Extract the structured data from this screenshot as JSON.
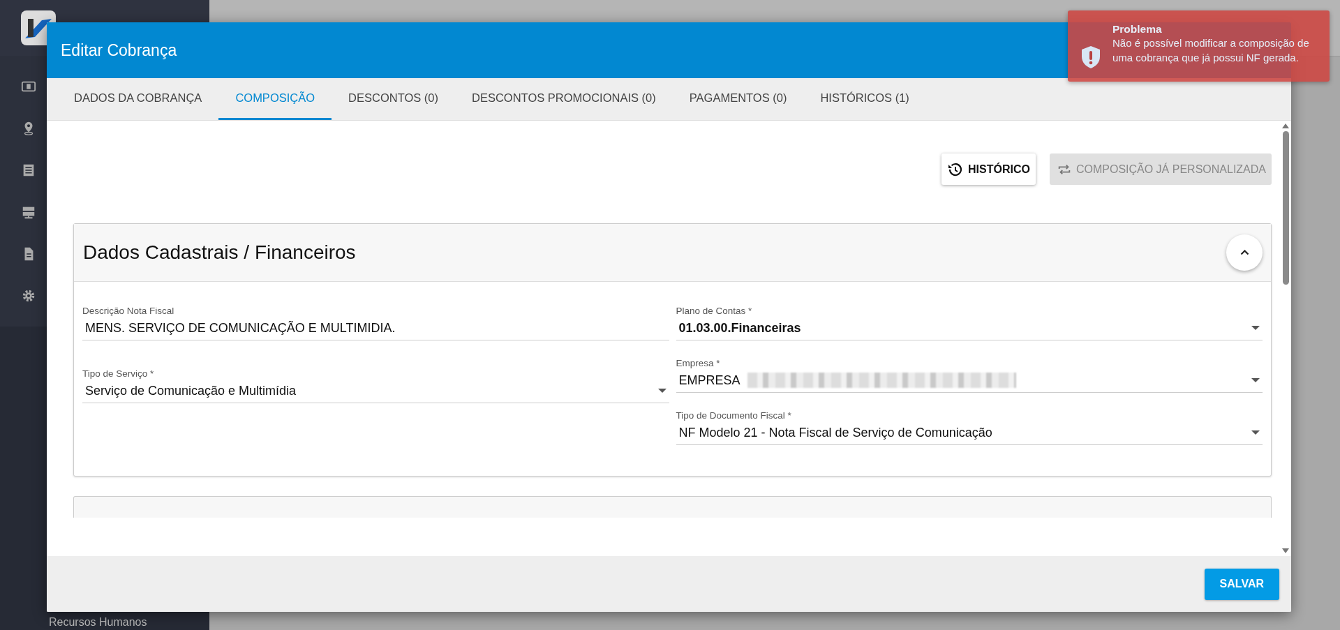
{
  "sidebar": {
    "items": [
      {
        "kind": "money"
      },
      {
        "kind": "pin"
      },
      {
        "kind": "list"
      },
      {
        "kind": "server"
      },
      {
        "kind": "document"
      },
      {
        "kind": "gear"
      }
    ],
    "footer_label": "Recursos Humanos"
  },
  "window": {
    "title": "Editar Cobrança"
  },
  "tabs": [
    {
      "label": "DADOS DA COBRANÇA",
      "selected": false
    },
    {
      "label": "COMPOSIÇÃO",
      "selected": true
    },
    {
      "label": "DESCONTOS (0)",
      "selected": false
    },
    {
      "label": "DESCONTOS PROMOCIONAIS (0)",
      "selected": false
    },
    {
      "label": "PAGAMENTOS (0)",
      "selected": false
    },
    {
      "label": "HISTÓRICOS (1)",
      "selected": false
    }
  ],
  "actions": [
    {
      "kind": "history",
      "label": "HISTÓRICO",
      "disabled": false
    },
    {
      "kind": "swap",
      "label": "COMPOSIÇÃO JÁ PERSONALIZADA",
      "disabled": true
    }
  ],
  "section": {
    "title": "Dados Cadastrais / Financeiros",
    "expanded": true
  },
  "left_fields": [
    {
      "kind": "text",
      "label": "Descrição Nota Fiscal",
      "value": "MENS. SERVIÇO DE COMUNICAÇÃO E MULTIMIDIA.",
      "bold": false,
      "redacted": false
    },
    {
      "kind": "select",
      "label": "Tipo de Serviço *",
      "value": "Serviço de Comunicação e Multimídia",
      "bold": false,
      "redacted": false
    }
  ],
  "right_fields": [
    {
      "kind": "select",
      "label": "Plano de Contas *",
      "value": "01.03.00.Financeiras",
      "bold": true,
      "redacted": false
    },
    {
      "kind": "select",
      "label": "Empresa *",
      "value": "EMPRESA",
      "bold": false,
      "redacted": true
    },
    {
      "kind": "select",
      "label": "Tipo de Documento Fiscal *",
      "value": "NF Modelo 21 - Nota Fiscal de Serviço de Comunicação",
      "bold": false,
      "redacted": false
    }
  ],
  "footer": {
    "save_label": "SALVAR"
  },
  "toast": {
    "title": "Problema",
    "message": "Não é possível modificar a composição de uma cobrança que já possui NF gerada."
  }
}
